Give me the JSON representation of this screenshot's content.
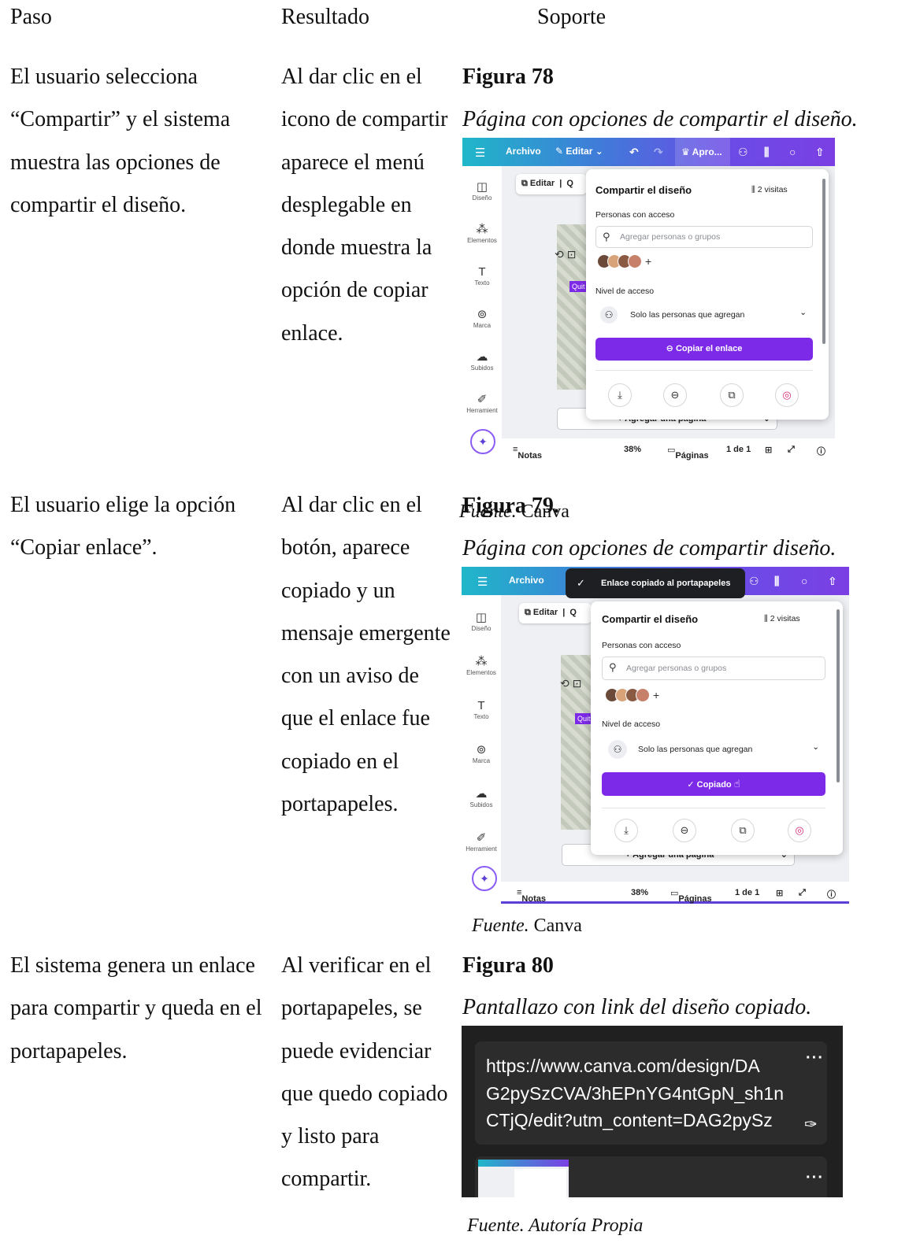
{
  "headers": {
    "paso": "Paso",
    "resultado": "Resultado",
    "soporte": "Soporte"
  },
  "rows": [
    {
      "paso": "El usuario selecciona “Compartir” y el sistema muestra las opciones de compartir el diseño.",
      "resultado": "Al dar clic en el icono de compartir aparece el menú desplegable en donde muestra la opción de copiar enlace.",
      "figure_title": "Figura 78",
      "figure_caption": "Página con opciones de compartir el diseño."
    },
    {
      "paso": "El usuario elige la opción “Copiar enlace”.",
      "resultado": "Al dar clic en el botón, aparece copiado y un mensaje emergente con un aviso de que el enlace fue copiado en el portapapeles.",
      "figure_title": "Figura 79.",
      "figure_caption": "Página con opciones de compartir diseño.",
      "overlap_source_label": "Fuente.",
      "overlap_source_text": " Canva",
      "source_label": "Fuente.",
      "source_text": " Canva"
    },
    {
      "paso": "El sistema genera un enlace para compartir y queda en el portapapeles.",
      "resultado": "Al verificar en el portapapeles, se puede evidenciar que quedo copiado y listo para compartir.",
      "figure_title": "Figura 80",
      "figure_caption": "Pantallazo con link del diseño copiado.",
      "source_text": "Fuente. Autoría Propia"
    }
  ],
  "canva": {
    "menu": "Archivo",
    "edit": "Editar",
    "apro": "Apro...",
    "edit_btn": "Editar",
    "q": "Q",
    "q2": "Q",
    "quit": "Quit",
    "share_title": "Compartir el diseño",
    "visits": "2 visitas",
    "people_label": "Personas con acceso",
    "search_placeholder": "Agregar personas o grupos",
    "access_label": "Nivel de acceso",
    "access_value": "Solo las personas que agregan",
    "copy_link": "Copiar el enlace",
    "copied": "Copiado",
    "toast": "Enlace copiado al portapapeles",
    "add_page": "+ Agregar una página",
    "notes": "Notas",
    "zoom": "38%",
    "pages": "Páginas",
    "page_count": "1 de 1",
    "sidebar": [
      "Diseño",
      "Elementos",
      "Texto",
      "Marca",
      "Subidos",
      "Herramient"
    ]
  },
  "clipboard": {
    "link_text": "https://www.canva.com/design/DAG2pySzCVA/3hEPnYG4ntGpN_sh1nCTjQ/edit?utm_content=DAG2pySz",
    "line1": "https://www.canva.com/design/DA",
    "line2": "G2pySzCVA/3hEPnYG4ntGpN_sh1n",
    "line3": "CTjQ/edit?utm_content=DAG2pySz",
    "more": "···"
  },
  "colors": {
    "canva_purple": "#7d2ae8",
    "clipboard_bg": "#202020",
    "clipboard_card": "#2c2c2c"
  }
}
